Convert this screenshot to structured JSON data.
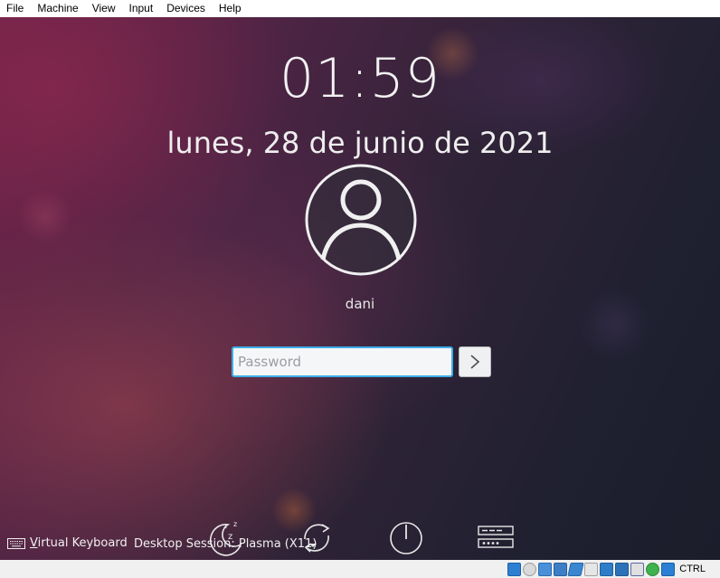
{
  "menu": {
    "items": [
      "File",
      "Machine",
      "View",
      "Input",
      "Devices",
      "Help"
    ]
  },
  "lockscreen": {
    "time": "01:59",
    "date": "lunes, 28 de junio de 2021",
    "username": "dani",
    "password_placeholder": "Password",
    "virtual_keyboard_label": "Virtual Keyboard",
    "session_label": "Desktop Session: Plasma (X11)"
  },
  "icons": {
    "avatar": "user-avatar-icon",
    "login_arrow": "chevron-right-icon",
    "sleep": "sleep-icon",
    "restart": "restart-icon",
    "shutdown": "power-icon",
    "switch_user": "switch-user-icon",
    "keyboard": "keyboard-icon"
  },
  "statusbar": {
    "host_key": "CTRL",
    "icons": [
      "hard-disk-icon",
      "optical-drive-icon",
      "audio-icon",
      "network-icon",
      "usb-icon",
      "shared-folder-icon",
      "display-icon",
      "video-capture-icon",
      "cpu-icon",
      "guest-additions-icon",
      "mouse-integration-icon"
    ]
  },
  "colors": {
    "accent": "#3daee9",
    "menubar_bg": "#ffffff",
    "statusbar_bg": "#f0f0f0"
  }
}
